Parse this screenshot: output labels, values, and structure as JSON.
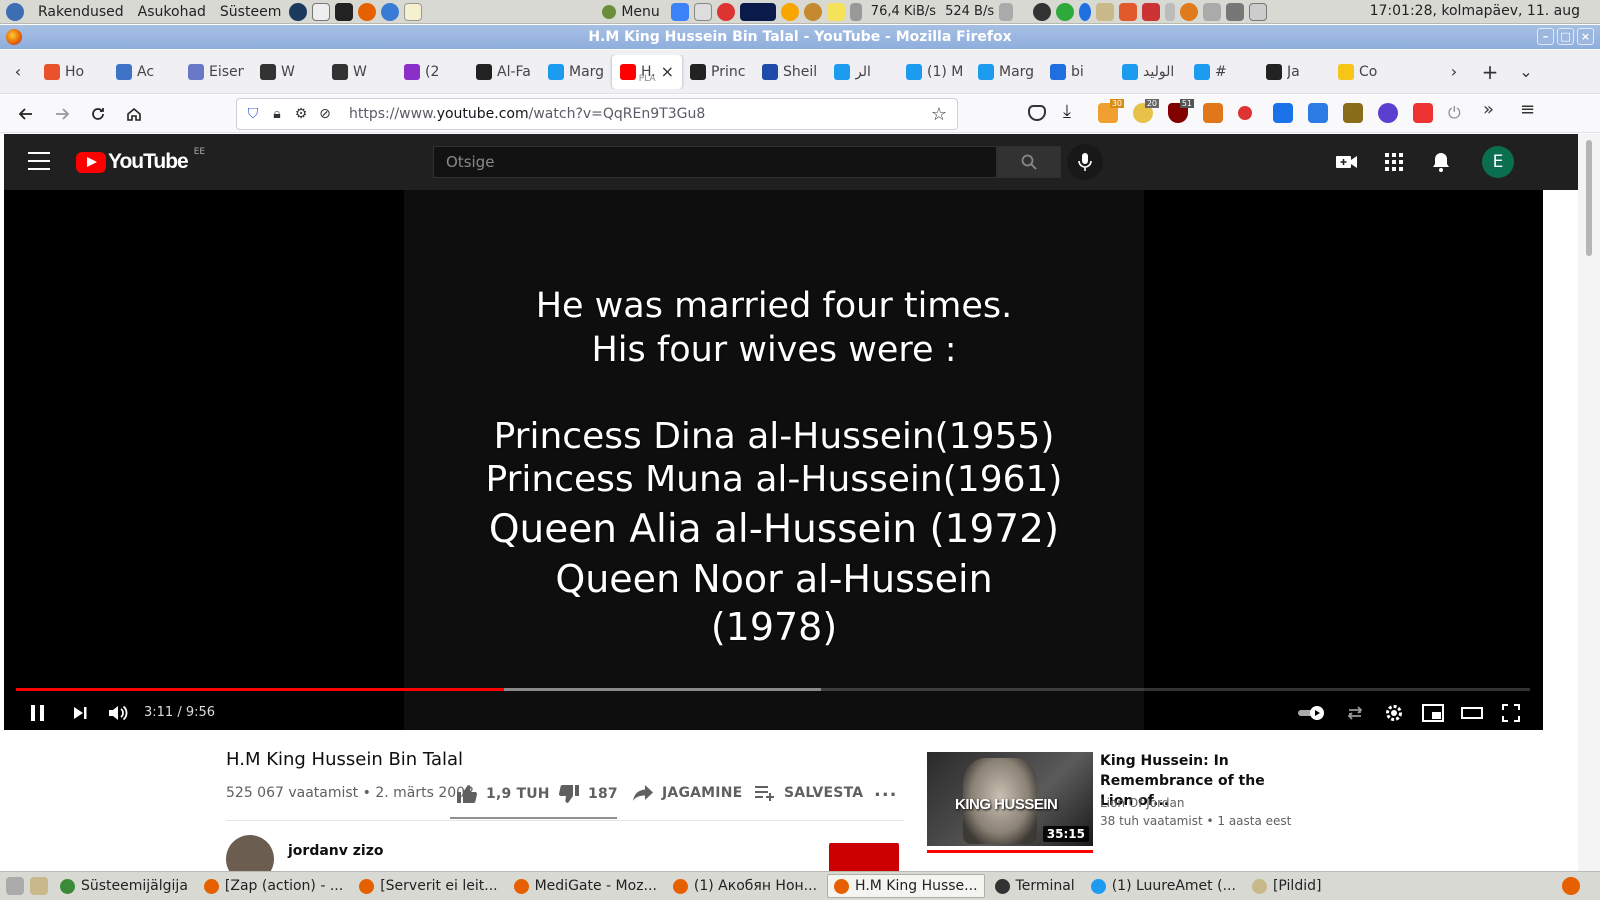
{
  "system_panel": {
    "menus": [
      "Rakendused",
      "Asukohad",
      "Süsteem"
    ],
    "menu_label": "Menu",
    "net_down": "76,4 KiB/s",
    "net_up": "524 B/s",
    "clock": "17:01:28, kolmapäev, 11. aug"
  },
  "window": {
    "title": "H.M King Hussein Bin Talal - YouTube - Mozilla Firefox"
  },
  "tabs": [
    {
      "label": "Ho",
      "icon": "ask-icon",
      "color": "#e8532c"
    },
    {
      "label": "Ac",
      "icon": "doc-icon",
      "color": "#3f73c8"
    },
    {
      "label": "Eisen",
      "icon": "sleep-icon",
      "color": "#6a78c8"
    },
    {
      "label": "W",
      "icon": "wiki-icon",
      "color": "#333333"
    },
    {
      "label": "W",
      "icon": "puzzle-icon",
      "color": "#333333"
    },
    {
      "label": "(2",
      "icon": "mail-icon",
      "color": "#8b2fc9"
    },
    {
      "label": "Al-Fa",
      "icon": "wikipedia-icon",
      "color": "#222222"
    },
    {
      "label": "Marg",
      "icon": "twitter-icon",
      "color": "#1d9bf0"
    },
    {
      "label": "H.M",
      "sublabel": "PLA",
      "icon": "youtube-icon",
      "color": "#ff0000",
      "active": true
    },
    {
      "label": "Princ",
      "icon": "wikipedia-icon",
      "color": "#222222"
    },
    {
      "label": "Sheil",
      "icon": "n-icon",
      "color": "#1f4aa8"
    },
    {
      "label": "الر",
      "icon": "twitter-icon",
      "color": "#1d9bf0"
    },
    {
      "label": "(1) M",
      "icon": "twitter-icon",
      "color": "#1d9bf0"
    },
    {
      "label": "Marg",
      "icon": "twitter-icon",
      "color": "#1d9bf0"
    },
    {
      "label": "bi",
      "icon": "bing-icon",
      "color": "#1f6fe0"
    },
    {
      "label": "الوليد",
      "icon": "twitter-icon",
      "color": "#1d9bf0"
    },
    {
      "label": "#",
      "icon": "twitter-icon",
      "color": "#1d9bf0"
    },
    {
      "label": "Ja",
      "icon": "wikipedia-icon",
      "color": "#222222"
    },
    {
      "label": "Co",
      "icon": "imdb-icon",
      "color": "#f5c518"
    }
  ],
  "nav": {
    "url_prefix": "https://www.",
    "url_domain": "youtube.com",
    "url_path": "/watch?v=QqREn9T3Gu8",
    "ext_badges": [
      "30",
      "20",
      "51"
    ]
  },
  "youtube": {
    "logo_text": "YouTube",
    "country": "EE",
    "search_placeholder": "Otsige",
    "avatar_letter": "E"
  },
  "video": {
    "lines": [
      "He was married four times.",
      "His four wives were :",
      "Princess Dina  al-Hussein(1955)",
      "Princess Muna al-Hussein(1961)",
      "Queen Alia al-Hussein (1972)",
      "Queen Noor al-Hussein",
      "(1978)"
    ],
    "time": "3:11 / 9:56",
    "played_fraction": 0.322,
    "buffered_fraction": 0.532,
    "title": "H.M King Hussein Bin Talal",
    "meta": "525 067 vaatamist • 2. märts 2008",
    "likes": "1,9 TUH",
    "dislikes": "187",
    "share": "JAGAMINE",
    "save": "SALVESTA",
    "more": "...",
    "channel": "jordanv zizo"
  },
  "recommended": {
    "title": "King Hussein: In Remembrance of the Lion of...",
    "thumb_text": "KING HUSSEIN",
    "duration": "35:15",
    "channel": "Lion Of Jordan",
    "meta": "38 tuh vaatamist • 1 aasta eest"
  },
  "taskbar": [
    {
      "label": "Süsteemijälgija",
      "color": "#3a8a3a"
    },
    {
      "label": "[Zap (action) - ...",
      "color": "#e66000"
    },
    {
      "label": "[Serverit ei leit...",
      "color": "#e66000"
    },
    {
      "label": "MediGate - Moz...",
      "color": "#e66000"
    },
    {
      "label": "(1) Акобян Нон...",
      "color": "#e66000"
    },
    {
      "label": "H.M King Husse...",
      "color": "#e66000",
      "active": true
    },
    {
      "label": "Terminal",
      "color": "#333333"
    },
    {
      "label": "(1) LuureAmet (...",
      "color": "#1d9bf0"
    },
    {
      "label": "[Pildid]",
      "color": "#c8b88a"
    }
  ]
}
